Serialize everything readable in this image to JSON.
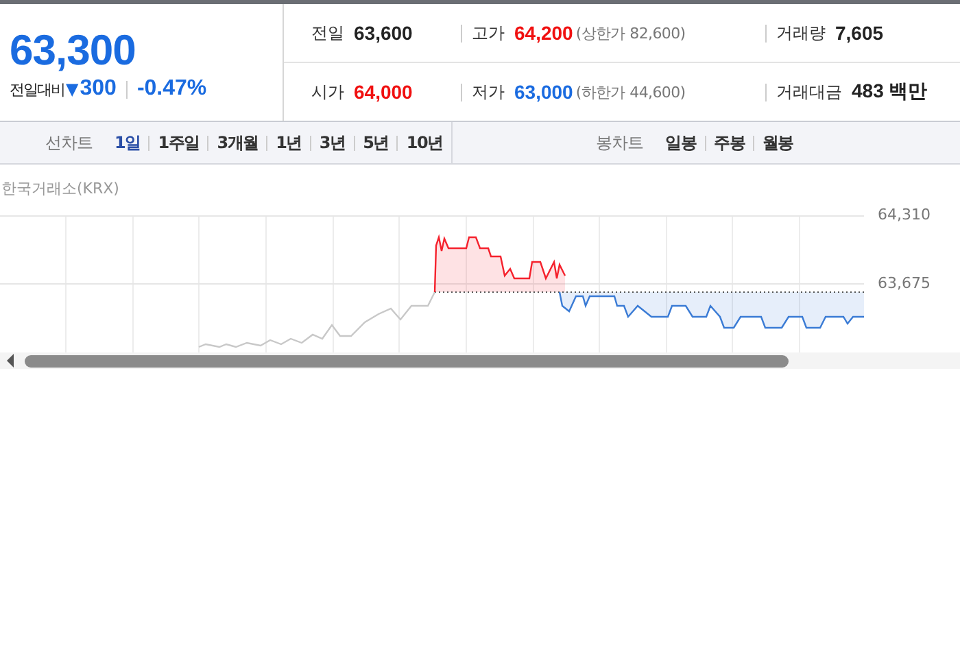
{
  "price": {
    "current": "63,300",
    "change_label": "전일대비",
    "change_icon": "▼",
    "change": "300",
    "change_pct": "-0.47%",
    "color": "#1a6be0"
  },
  "stats": [
    [
      {
        "label": "전일",
        "value": "63,600",
        "color": "#222222"
      },
      {
        "label": "고가",
        "value": "64,200",
        "color": "#f01010",
        "note": "(상한가 82,600)"
      },
      {
        "label": "거래량",
        "value": "7,605",
        "color": "#222222"
      }
    ],
    [
      {
        "label": "시가",
        "value": "64,000",
        "color": "#f01010"
      },
      {
        "label": "저가",
        "value": "63,000",
        "color": "#1a6be0",
        "note": "(하한가 44,600)"
      },
      {
        "label": "거래대금",
        "value": "483 백만",
        "color": "#222222"
      }
    ]
  ],
  "line_chart_tabs": {
    "label": "선차트",
    "items": [
      {
        "label": "1일",
        "selected": true
      },
      {
        "label": "1주일",
        "selected": false
      },
      {
        "label": "3개월",
        "selected": false
      },
      {
        "label": "1년",
        "selected": false
      },
      {
        "label": "3년",
        "selected": false
      },
      {
        "label": "5년",
        "selected": false
      },
      {
        "label": "10년",
        "selected": false
      }
    ]
  },
  "candle_chart_tabs": {
    "label": "봉차트",
    "items": [
      {
        "label": "일봉",
        "selected": false
      },
      {
        "label": "주봉",
        "selected": false
      },
      {
        "label": "월봉",
        "selected": false
      }
    ]
  },
  "chart": {
    "exchange": "한국거래소(KRX)",
    "axis_labels": [
      "64,310",
      "63,675"
    ]
  }
}
